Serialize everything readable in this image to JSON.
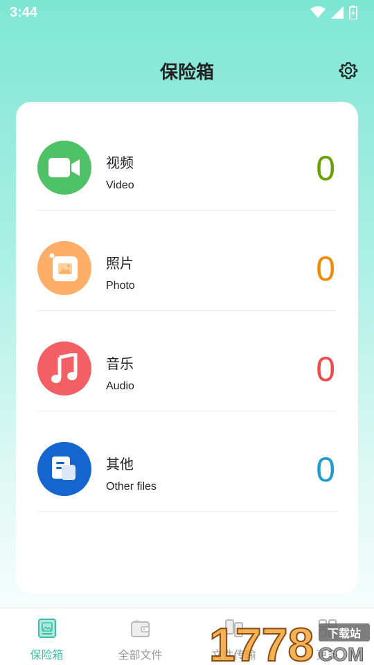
{
  "status": {
    "time": "3:44"
  },
  "header": {
    "title": "保险箱"
  },
  "items": [
    {
      "title": "视频",
      "subtitle": "Video",
      "count": "0",
      "color": "#68a100",
      "icon_bg": "#4fc268",
      "icon": "video-camera-icon"
    },
    {
      "title": "照片",
      "subtitle": "Photo",
      "count": "0",
      "color": "#f28a00",
      "icon_bg": "#ffae68",
      "icon": "photo-icon"
    },
    {
      "title": "音乐",
      "subtitle": "Audio",
      "count": "0",
      "color": "#ef4b4b",
      "icon_bg": "#f45f63",
      "icon": "music-note-icon"
    },
    {
      "title": "其他",
      "subtitle": "Other files",
      "count": "0",
      "color": "#1f9bd0",
      "icon_bg": "#1565cf",
      "icon": "document-icon"
    }
  ],
  "nav": [
    {
      "label": "保险箱",
      "icon": "vault-icon",
      "active": true
    },
    {
      "label": "全部文件",
      "icon": "folder-icon",
      "active": false
    },
    {
      "label": "文件传输",
      "icon": "transfer-icon",
      "active": false
    },
    {
      "label": "更多",
      "icon": "more-icon",
      "active": false
    }
  ],
  "watermark": {
    "text": "1778",
    "badge": "下载站",
    "domain": "COM"
  },
  "colors": {
    "accent": "#3bbfa8",
    "header_gradient_top": "#7fe6d4"
  }
}
